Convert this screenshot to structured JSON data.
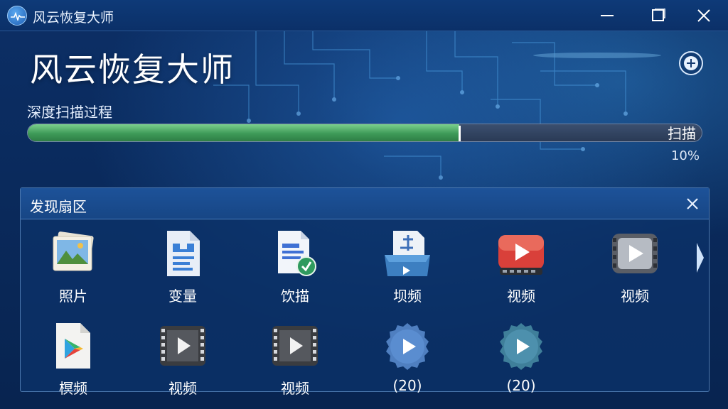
{
  "window": {
    "title": "风云恢复大师",
    "minimize_label": "",
    "colors": {
      "accent": "#3e9a58",
      "background": "#0a2a5c",
      "panel": "#174685"
    }
  },
  "header": {
    "big_title": "风云恢复大师"
  },
  "scan": {
    "label": "深度扫描过程",
    "button_text": "扫描",
    "percent_text": "10%",
    "progress": 0.64
  },
  "panel": {
    "title": "发现扇区",
    "items": [
      {
        "label": "照片",
        "icon": "photo-icon"
      },
      {
        "label": "变量",
        "icon": "document-icon"
      },
      {
        "label": "饮描",
        "icon": "document-badge-icon"
      },
      {
        "label": "坝频",
        "icon": "scanner-tray-icon"
      },
      {
        "label": "视频",
        "icon": "video-red-icon"
      },
      {
        "label": "视频",
        "icon": "video-gray-icon"
      },
      {
        "label": "榠频",
        "icon": "play-store-file-icon"
      },
      {
        "label": "视频",
        "icon": "film-icon"
      },
      {
        "label": "视频",
        "icon": "film-icon"
      },
      {
        "label": "(20)",
        "icon": "play-badge-blue-icon"
      },
      {
        "label": "(20)",
        "icon": "play-badge-teal-icon"
      }
    ]
  }
}
